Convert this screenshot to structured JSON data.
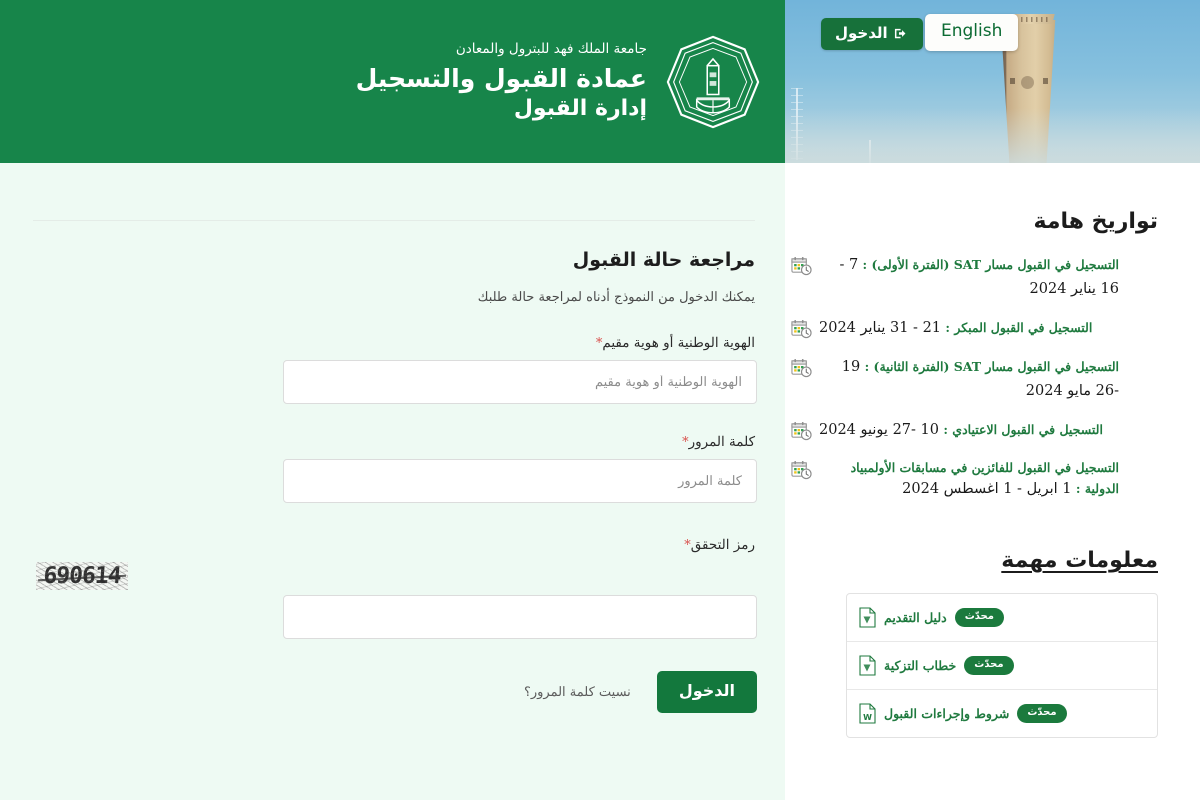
{
  "hero": {
    "login_button_label": "الدخول",
    "login_icon": "sign-in-arrow-icon",
    "language_toggle_label": "English"
  },
  "header": {
    "university_name": "جامعة الملك فهد للبترول والمعادن",
    "deanship": "عمادة القبول والتسجيل",
    "department": "إدارة القبول",
    "logo_icon": "kfupm-seal-logo",
    "background_color": "#17854a"
  },
  "sidebar": {
    "dates_section": {
      "title": "تواريخ هامة",
      "items": [
        {
          "icon": "calendar-clock-icon",
          "label": "التسجيل في القبول مسار SAT (الفترة الأولى) :",
          "value": "7 - 16 يناير 2024"
        },
        {
          "icon": "calendar-clock-icon",
          "label": "التسجيل في القبول المبكر :",
          "value": "21 - 31 يناير 2024"
        },
        {
          "icon": "calendar-clock-icon",
          "label": "التسجيل في القبول مسار SAT (الفترة الثانية) :",
          "value": "19 -26 مايو 2024"
        },
        {
          "icon": "calendar-clock-icon",
          "label": "التسجيل في القبول الاعتيادي :",
          "value": "10 -27 يونيو 2024"
        },
        {
          "icon": "calendar-clock-icon",
          "label": "التسجيل في القبول للفائزين في مسابقات الأولمبياد الدولية :",
          "value": "1 ابريل - 1 اغسطس 2024"
        }
      ]
    },
    "info_section": {
      "title": "معلومات مهمة",
      "documents": [
        {
          "icon": "pdf-file-icon",
          "label": "دليل التقديم",
          "badge": "محدّث"
        },
        {
          "icon": "pdf-file-icon",
          "label": "خطاب التزكية",
          "badge": "محدّث"
        },
        {
          "icon": "word-file-icon",
          "label": "شروط وإجراءات القبول",
          "badge": "محدّث"
        }
      ]
    }
  },
  "form": {
    "title": "مراجعة حالة القبول",
    "description": "يمكنك الدخول من النموذج أدناه لمراجعة حالة طلبك",
    "fields": [
      {
        "label": "الهوية الوطنية أو هوية مقيم",
        "required_mark": "*",
        "placeholder": "الهوية الوطنية أو هوية مقيم",
        "value": ""
      },
      {
        "label": "كلمة المرور",
        "required_mark": "*",
        "placeholder": "كلمة المرور",
        "value": ""
      }
    ],
    "captcha": {
      "label": "رمز التحقق",
      "required_mark": "*",
      "code": "690614",
      "placeholder": "",
      "value": ""
    },
    "submit_label": "الدخول",
    "forgot_password_label": "نسيت كلمة المرور؟",
    "accent_color": "#13783d",
    "panel_background": "#eefaf3"
  }
}
